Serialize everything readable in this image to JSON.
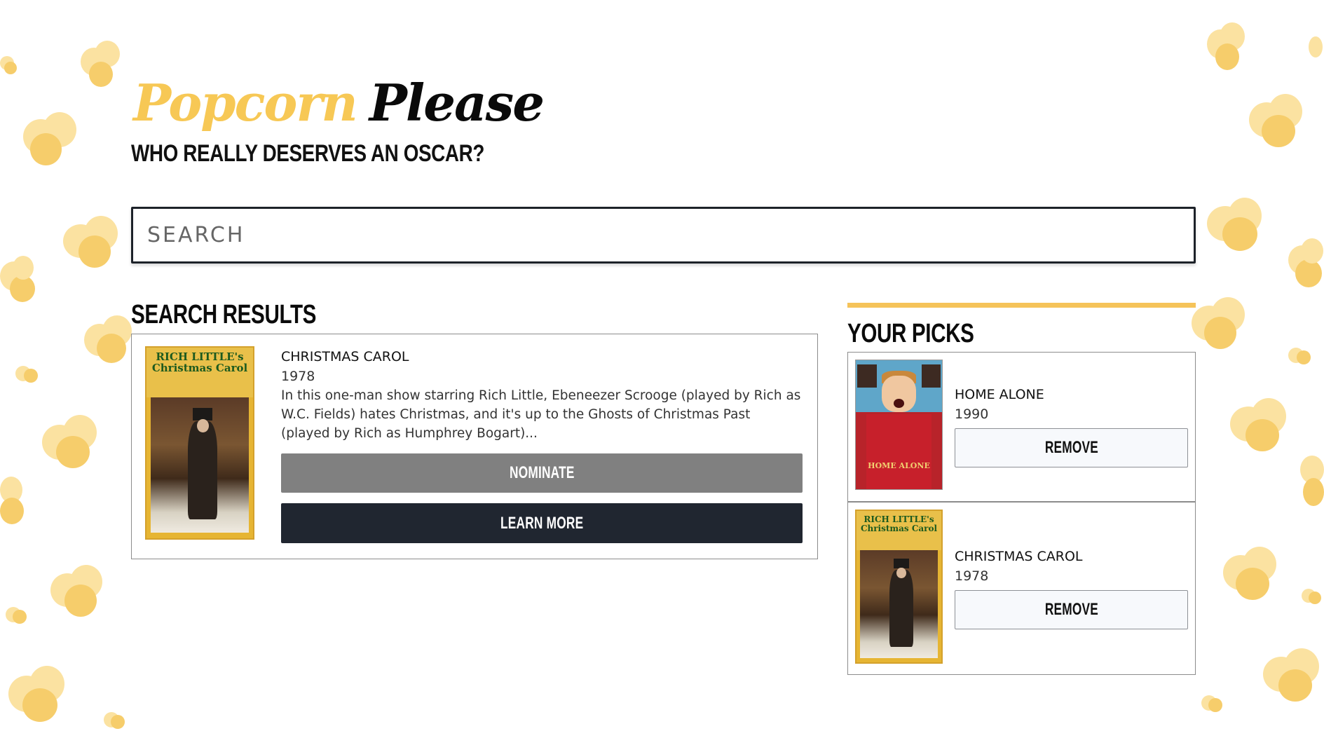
{
  "app": {
    "logo_word1": "Popcorn",
    "logo_word2": "Please",
    "tagline": "WHO REALLY DESERVES AN OSCAR?"
  },
  "search": {
    "placeholder": "SEARCH",
    "value": ""
  },
  "results": {
    "heading": "SEARCH RESULTS",
    "items": [
      {
        "poster_icon": "movie-poster-christmas-carol",
        "poster_banner": "RICH LITTLE's Christmas Carol",
        "title": "CHRISTMAS CAROL",
        "year": "1978",
        "plot": "In this one-man show starring Rich Little, Ebeneezer Scrooge (played by Rich as W.C. Fields) hates Christmas, and it's up to the Ghosts of Christmas Past (played by Rich as Humphrey Bogart)...",
        "nominate_label": "NOMINATE",
        "nominate_disabled": true,
        "learn_more_label": "LEARN MORE"
      }
    ]
  },
  "picks": {
    "heading": "YOUR PICKS",
    "items": [
      {
        "poster_icon": "movie-poster-home-alone",
        "poster_title": "HOME ALONE",
        "title": "HOME ALONE",
        "year": "1990",
        "remove_label": "REMOVE"
      },
      {
        "poster_icon": "movie-poster-christmas-carol",
        "poster_banner": "RICH LITTLE's Christmas Carol",
        "title": "CHRISTMAS CAROL",
        "year": "1978",
        "remove_label": "REMOVE"
      }
    ]
  },
  "colors": {
    "accent_yellow": "#f7c855",
    "popcorn": "#fbe2a1",
    "dark_button": "#202630",
    "disabled_button": "#808080"
  }
}
